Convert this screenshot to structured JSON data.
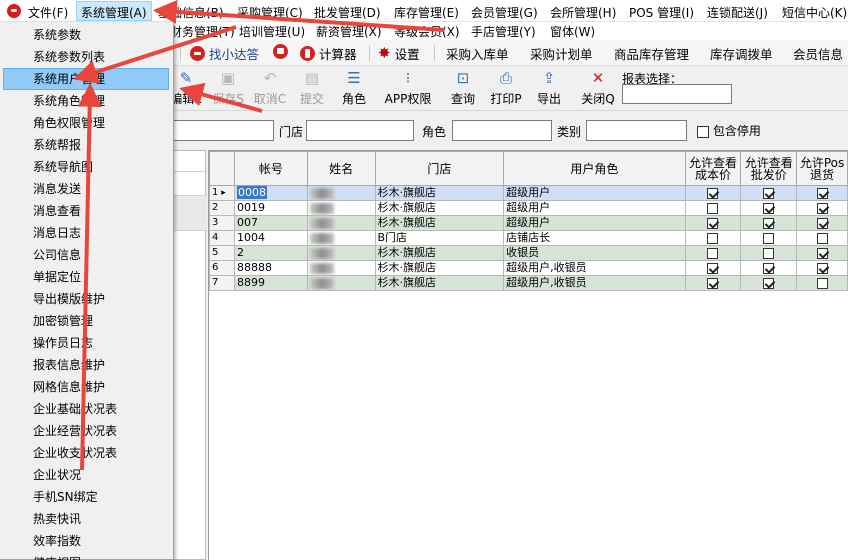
{
  "menubar": {
    "items": [
      "文件(F)",
      "系统管理(A)",
      "基础信息(B)",
      "采购管理(C)",
      "批发管理(D)",
      "库存管理(E)",
      "会员管理(G)",
      "会所管理(H)",
      "POS 管理(I)",
      "连锁配送(J)",
      "短信中心(K)"
    ]
  },
  "menurow2": {
    "items": [
      "财务管理(T)",
      "培训管理(U)",
      "薪资管理(X)",
      "等级会员(X)",
      "手店管理(Y)",
      "窗体(W)"
    ]
  },
  "quickbar": {
    "items": [
      "找小达答",
      "计算器",
      "设置",
      "采购入库单",
      "采购计划单",
      "商品库存管理",
      "库存调拨单",
      "会员信息"
    ]
  },
  "toolbar": {
    "buttons": [
      "编辑E",
      "保存S",
      "取消C",
      "提交",
      "角色",
      "APP权限",
      "查询",
      "打印P",
      "导出",
      "关闭Q"
    ],
    "report_label": "报表选择："
  },
  "filters": {
    "store_label": "门店",
    "role_label": "角色",
    "category_label": "类别",
    "include_disabled_label": "包含停用"
  },
  "grid": {
    "headers": [
      "帐号",
      "姓名",
      "门店",
      "用户角色",
      "允许查看\n成本价",
      "允许查看\n批发价",
      "允许Pos\n退货"
    ],
    "rows": [
      {
        "n": "1",
        "account": "0008",
        "store": "杉木·旗舰店",
        "role": "超级用户",
        "cost": true,
        "wholesale": true,
        "pos": true
      },
      {
        "n": "2",
        "account": "0019",
        "store": "杉木·旗舰店",
        "role": "超级用户",
        "cost": false,
        "wholesale": true,
        "pos": true
      },
      {
        "n": "3",
        "account": "007",
        "store": "杉木·旗舰店",
        "role": "超级用户",
        "cost": true,
        "wholesale": true,
        "pos": true
      },
      {
        "n": "4",
        "account": "1004",
        "store": "B门店",
        "role": "店铺店长",
        "cost": false,
        "wholesale": false,
        "pos": false
      },
      {
        "n": "5",
        "account": "2",
        "store": "杉木·旗舰店",
        "role": "收银员",
        "cost": false,
        "wholesale": false,
        "pos": true
      },
      {
        "n": "6",
        "account": "88888",
        "store": "杉木·旗舰店",
        "role": "超级用户,收银员",
        "cost": true,
        "wholesale": true,
        "pos": true
      },
      {
        "n": "7",
        "account": "8899",
        "store": "杉木·旗舰店",
        "role": "超级用户,收银员",
        "cost": true,
        "wholesale": true,
        "pos": false
      }
    ]
  },
  "sysmenu": {
    "items": [
      "系统参数",
      "系统参数列表",
      "系统用户管理",
      "系统角色管理",
      "角色权限管理",
      "系统帮报",
      "系统导航图",
      "消息发送",
      "消息查看",
      "消息日志",
      "公司信息",
      "单据定位",
      "导出模版维护",
      "加密锁管理",
      "操作员日志",
      "报表信息维护",
      "网格信息维护",
      "企业基础状况表",
      "企业经营状况表",
      "企业收支状况表",
      "企业状况",
      "手机SN绑定",
      "热卖快讯",
      "效率指数",
      "健康视图"
    ],
    "highlighted": "系统用户管理"
  },
  "colors": {
    "menu_highlight": "#91c9f7",
    "row_alt": "#d6e4d6",
    "row_selected": "#cfe0f6",
    "arrow": "#e8453c"
  }
}
